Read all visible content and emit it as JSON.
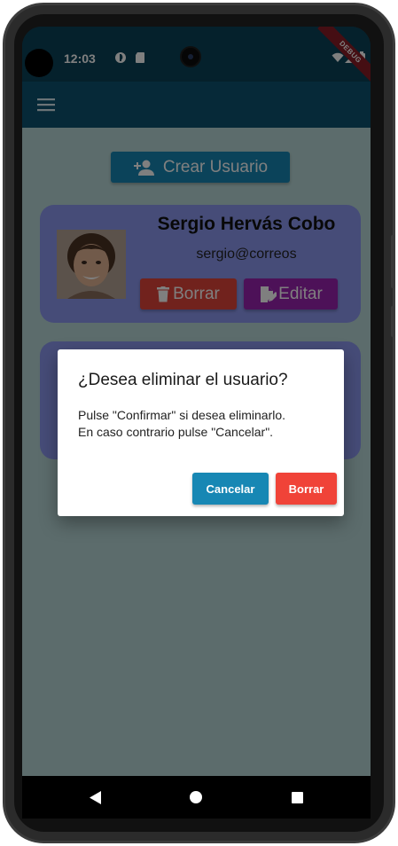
{
  "status_bar": {
    "time": "12:03",
    "icons": [
      "assistant-icon",
      "sd-card-icon",
      "wifi-icon",
      "signal-icon",
      "battery-icon"
    ],
    "debug_banner": "DEBUG"
  },
  "app_bar": {
    "menu_icon": "hamburger-menu-icon",
    "color": "#0d5370"
  },
  "create_button": {
    "label": "Crear Usuario",
    "icon": "person-add-icon"
  },
  "users": [
    {
      "name": "Sergio Hervás Cobo",
      "email": "sergio@correos",
      "delete_label": "Borrar",
      "edit_label": "Editar"
    }
  ],
  "dialog": {
    "title": "¿Desea eliminar el usuario?",
    "body_line1": "Pulse \"Confirmar\" si desea eliminarlo.",
    "body_line2": "En caso contrario pulse \"Cancelar\".",
    "cancel_label": "Cancelar",
    "confirm_label": "Borrar"
  },
  "colors": {
    "accent": "#1787b4",
    "danger": "#f04338",
    "edit": "#9a22b0",
    "card": "#8d99f1",
    "background": "#b9d9d8"
  }
}
